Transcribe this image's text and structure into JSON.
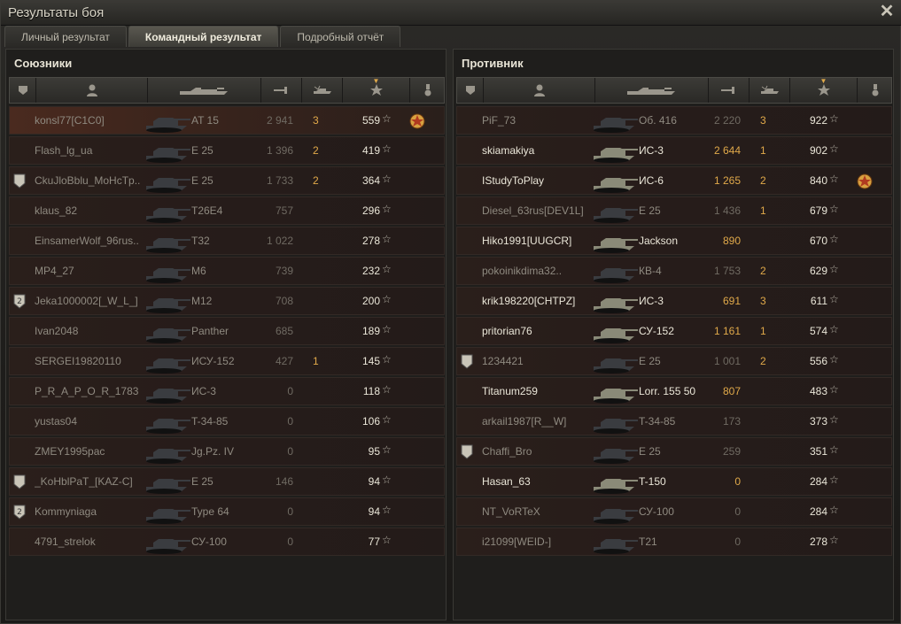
{
  "window": {
    "title": "Результаты боя"
  },
  "tabs": [
    {
      "label": "Личный результат"
    },
    {
      "label": "Командный результат"
    },
    {
      "label": "Подробный отчёт"
    }
  ],
  "allies": {
    "title": "Союзники",
    "rows": [
      {
        "name": "konsl77[C1C0]",
        "tank": "AT 15",
        "damage": "2 941",
        "kills": "3",
        "xp": "559",
        "alive": false,
        "hl": true,
        "medal": true,
        "badge": ""
      },
      {
        "name": "Flash_lg_ua",
        "tank": "E 25",
        "damage": "1 396",
        "kills": "2",
        "xp": "419",
        "alive": false
      },
      {
        "name": "CkuJloBblu_MoHcTp..",
        "tank": "E 25",
        "damage": "1 733",
        "kills": "2",
        "xp": "364",
        "alive": false,
        "badge": "1"
      },
      {
        "name": "klaus_82",
        "tank": "T26E4",
        "damage": "757",
        "kills": "",
        "xp": "296",
        "alive": false
      },
      {
        "name": "EinsamerWolf_96rus..",
        "tank": "T32",
        "damage": "1 022",
        "kills": "",
        "xp": "278",
        "alive": false
      },
      {
        "name": "MP4_27",
        "tank": "M6",
        "damage": "739",
        "kills": "",
        "xp": "232",
        "alive": false
      },
      {
        "name": "Jeka1000002[_W_L_]",
        "tank": "M12",
        "damage": "708",
        "kills": "",
        "xp": "200",
        "alive": false,
        "badge": "2"
      },
      {
        "name": "Ivan2048",
        "tank": "Panther",
        "damage": "685",
        "kills": "",
        "xp": "189",
        "alive": false
      },
      {
        "name": "SERGEI19820110",
        "tank": "ИСУ-152",
        "damage": "427",
        "kills": "1",
        "xp": "145",
        "alive": false
      },
      {
        "name": "P_R_A_P_O_R_1783",
        "tank": "ИС-3",
        "damage": "0",
        "kills": "",
        "xp": "118",
        "alive": false
      },
      {
        "name": "yustas04",
        "tank": "T-34-85",
        "damage": "0",
        "kills": "",
        "xp": "106",
        "alive": false
      },
      {
        "name": "ZMEY1995pac",
        "tank": "Jg.Pz. IV",
        "damage": "0",
        "kills": "",
        "xp": "95",
        "alive": false
      },
      {
        "name": "_KoHblPaT_[KAZ-C]",
        "tank": "E 25",
        "damage": "146",
        "kills": "",
        "xp": "94",
        "alive": false,
        "badge": "1"
      },
      {
        "name": "Kommyniaga",
        "tank": "Type 64",
        "damage": "0",
        "kills": "",
        "xp": "94",
        "alive": false,
        "badge": "2"
      },
      {
        "name": "4791_strelok",
        "tank": "СУ-100",
        "damage": "0",
        "kills": "",
        "xp": "77",
        "alive": false
      }
    ]
  },
  "enemies": {
    "title": "Противник",
    "rows": [
      {
        "name": "PiF_73",
        "tank": "Об. 416",
        "damage": "2 220",
        "kills": "3",
        "xp": "922",
        "alive": false
      },
      {
        "name": "skiamakiya",
        "tank": "ИС-3",
        "damage": "2 644",
        "kills": "1",
        "xp": "902",
        "alive": true
      },
      {
        "name": "IStudyToPlay",
        "tank": "ИС-6",
        "damage": "1 265",
        "kills": "2",
        "xp": "840",
        "alive": true,
        "medal": true
      },
      {
        "name": "Diesel_63rus[DEV1L]",
        "tank": "E 25",
        "damage": "1 436",
        "kills": "1",
        "xp": "679",
        "alive": false
      },
      {
        "name": "Hiko1991[UUGCR]",
        "tank": "Jackson",
        "damage": "890",
        "kills": "",
        "xp": "670",
        "alive": true
      },
      {
        "name": "pokoinikdima32..",
        "tank": "КВ-4",
        "damage": "1 753",
        "kills": "2",
        "xp": "629",
        "alive": false
      },
      {
        "name": "krik198220[CHTPZ]",
        "tank": "ИС-3",
        "damage": "691",
        "kills": "3",
        "xp": "611",
        "alive": true
      },
      {
        "name": "pritorian76",
        "tank": "СУ-152",
        "damage": "1 161",
        "kills": "1",
        "xp": "574",
        "alive": true
      },
      {
        "name": "1234421",
        "tank": "E 25",
        "damage": "1 001",
        "kills": "2",
        "xp": "556",
        "alive": false,
        "badge": "1"
      },
      {
        "name": "Titanum259",
        "tank": "Lorr. 155 50",
        "damage": "807",
        "kills": "",
        "xp": "483",
        "alive": true
      },
      {
        "name": "arkail1987[R__W]",
        "tank": "T-34-85",
        "damage": "173",
        "kills": "",
        "xp": "373",
        "alive": false
      },
      {
        "name": "Chaffi_Bro",
        "tank": "E 25",
        "damage": "259",
        "kills": "",
        "xp": "351",
        "alive": false,
        "badge": "1"
      },
      {
        "name": "Hasan_63",
        "tank": "T-150",
        "damage": "0",
        "kills": "",
        "xp": "284",
        "alive": true
      },
      {
        "name": "NT_VoRTeX",
        "tank": "СУ-100",
        "damage": "0",
        "kills": "",
        "xp": "284",
        "alive": false
      },
      {
        "name": "i21099[WEID-]",
        "tank": "T21",
        "damage": "0",
        "kills": "",
        "xp": "278",
        "alive": false
      }
    ]
  },
  "colors": {
    "accent": "#e0a94a",
    "alive_text": "#eae6d8",
    "dead_text": "#8f8a80"
  },
  "icons": {
    "header": [
      "badge-icon",
      "player-icon",
      "tank-icon",
      "damage-icon",
      "kills-icon",
      "star-icon",
      "medal-icon"
    ],
    "xp": "star-icon",
    "close": "close-icon"
  }
}
